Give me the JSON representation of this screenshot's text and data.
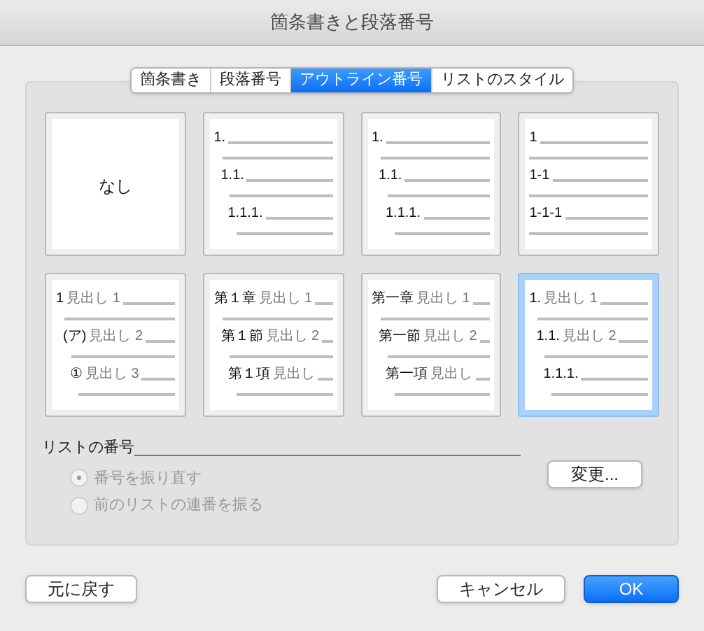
{
  "window": {
    "title": "箇条書きと段落番号"
  },
  "tabs": [
    {
      "label": "箇条書き",
      "selected": false
    },
    {
      "label": "段落番号",
      "selected": false
    },
    {
      "label": "アウトライン番号",
      "selected": true
    },
    {
      "label": "リストのスタイル",
      "selected": false
    }
  ],
  "styles": [
    {
      "kind": "none",
      "label": "なし",
      "selected": false
    },
    {
      "kind": "outline",
      "indented": true,
      "selected": false,
      "levels": [
        {
          "number": "1.",
          "children": [
            {
              "number": "1.1.",
              "children": [
                {
                  "number": "1.1.1."
                }
              ]
            }
          ]
        }
      ]
    },
    {
      "kind": "outline",
      "indented": true,
      "selected": false,
      "levels": [
        {
          "number": "1.",
          "children": [
            {
              "number": "1.1.",
              "children": [
                {
                  "number": "1.1.1."
                }
              ]
            }
          ]
        }
      ]
    },
    {
      "kind": "outline",
      "indented": false,
      "selected": false,
      "levels": [
        {
          "number": "1",
          "children": [
            {
              "number": "1-1",
              "children": [
                {
                  "number": "1-1-1"
                }
              ]
            }
          ]
        }
      ]
    },
    {
      "kind": "outline",
      "indented": true,
      "selected": false,
      "levels": [
        {
          "number": "1",
          "heading": "見出し 1",
          "children": [
            {
              "number": "(ア)",
              "heading": "見出し 2",
              "children": [
                {
                  "number": "①",
                  "heading": "見出し 3"
                }
              ]
            }
          ]
        }
      ]
    },
    {
      "kind": "outline",
      "indented": true,
      "selected": false,
      "levels": [
        {
          "number": "第１章",
          "heading": "見出し 1",
          "children": [
            {
              "number": "第１節",
              "heading": "見出し 2",
              "children": [
                {
                  "number": "第１項",
                  "heading": "見出し"
                }
              ]
            }
          ]
        }
      ]
    },
    {
      "kind": "outline",
      "indented": true,
      "selected": false,
      "levels": [
        {
          "number": "第一章",
          "heading": "見出し 1",
          "children": [
            {
              "number": "第一節",
              "heading": "見出し 2",
              "children": [
                {
                  "number": "第一項",
                  "heading": "見出し"
                }
              ]
            }
          ]
        }
      ]
    },
    {
      "kind": "outline",
      "indented": true,
      "selected": true,
      "levels": [
        {
          "number": "1.",
          "heading": "見出し 1",
          "children": [
            {
              "number": "1.1.",
              "heading": "見出し 2",
              "children": [
                {
                  "number": "1.1.1."
                }
              ]
            }
          ]
        }
      ]
    }
  ],
  "numbering": {
    "label": "リストの番号",
    "options": [
      {
        "label": "番号を振り直す",
        "selected": true,
        "disabled": true
      },
      {
        "label": "前のリストの連番を振る",
        "selected": false,
        "disabled": true
      }
    ],
    "change_button": "変更..."
  },
  "buttons": {
    "reset": "元に戻す",
    "cancel": "キャンセル",
    "ok": "OK"
  }
}
